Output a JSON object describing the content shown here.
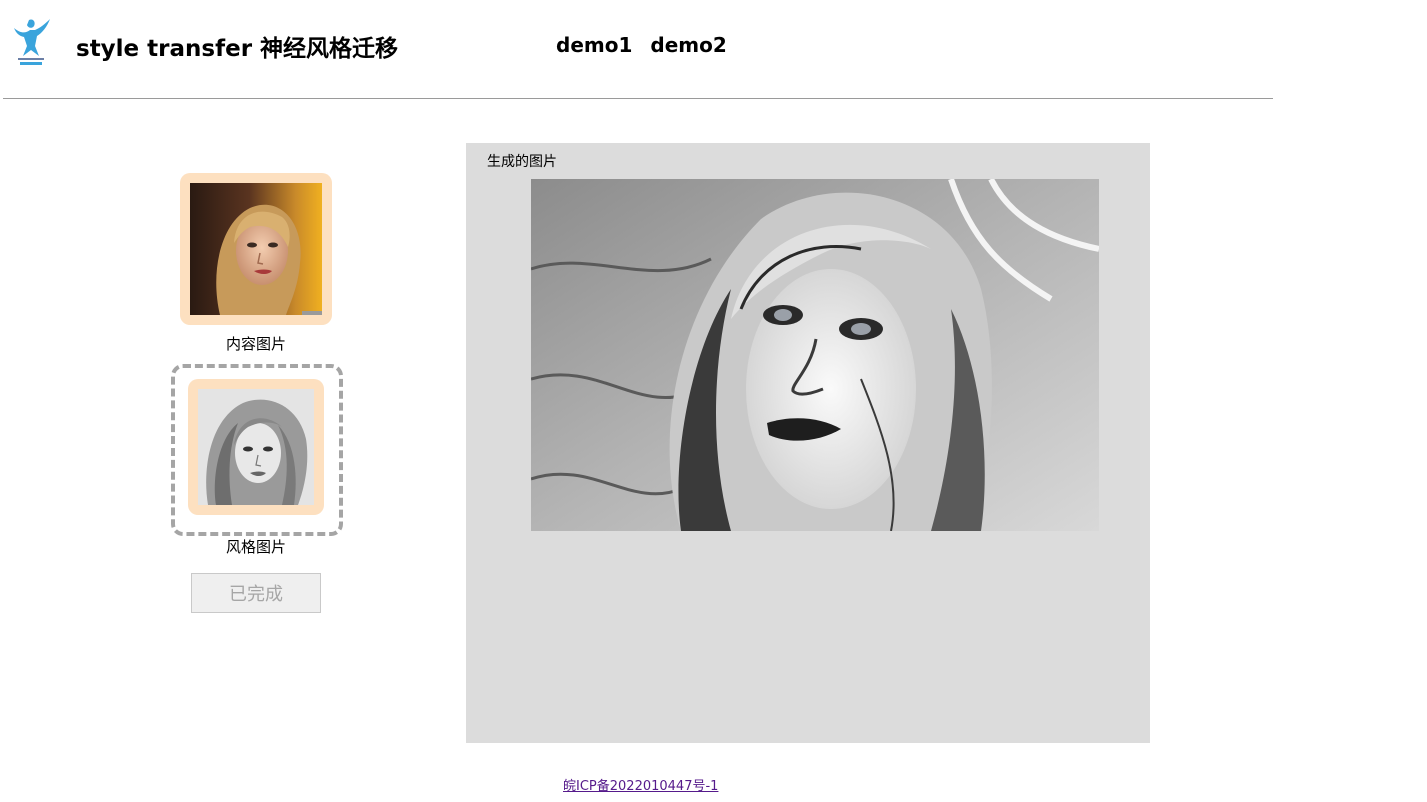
{
  "header": {
    "title": "style transfer 神经风格迁移",
    "nav": [
      {
        "label": "demo1"
      },
      {
        "label": "demo2"
      }
    ]
  },
  "left": {
    "content_label": "内容图片",
    "style_label": "风格图片",
    "done_button": "已完成"
  },
  "result": {
    "label": "生成的图片"
  },
  "footer": {
    "icp": "皖ICP备2022010447号-1"
  },
  "colors": {
    "card_border": "#fde0c0",
    "panel_bg": "#dcdcdc",
    "visited_link": "#551a8b",
    "logo_blue": "#3aa4dc"
  }
}
